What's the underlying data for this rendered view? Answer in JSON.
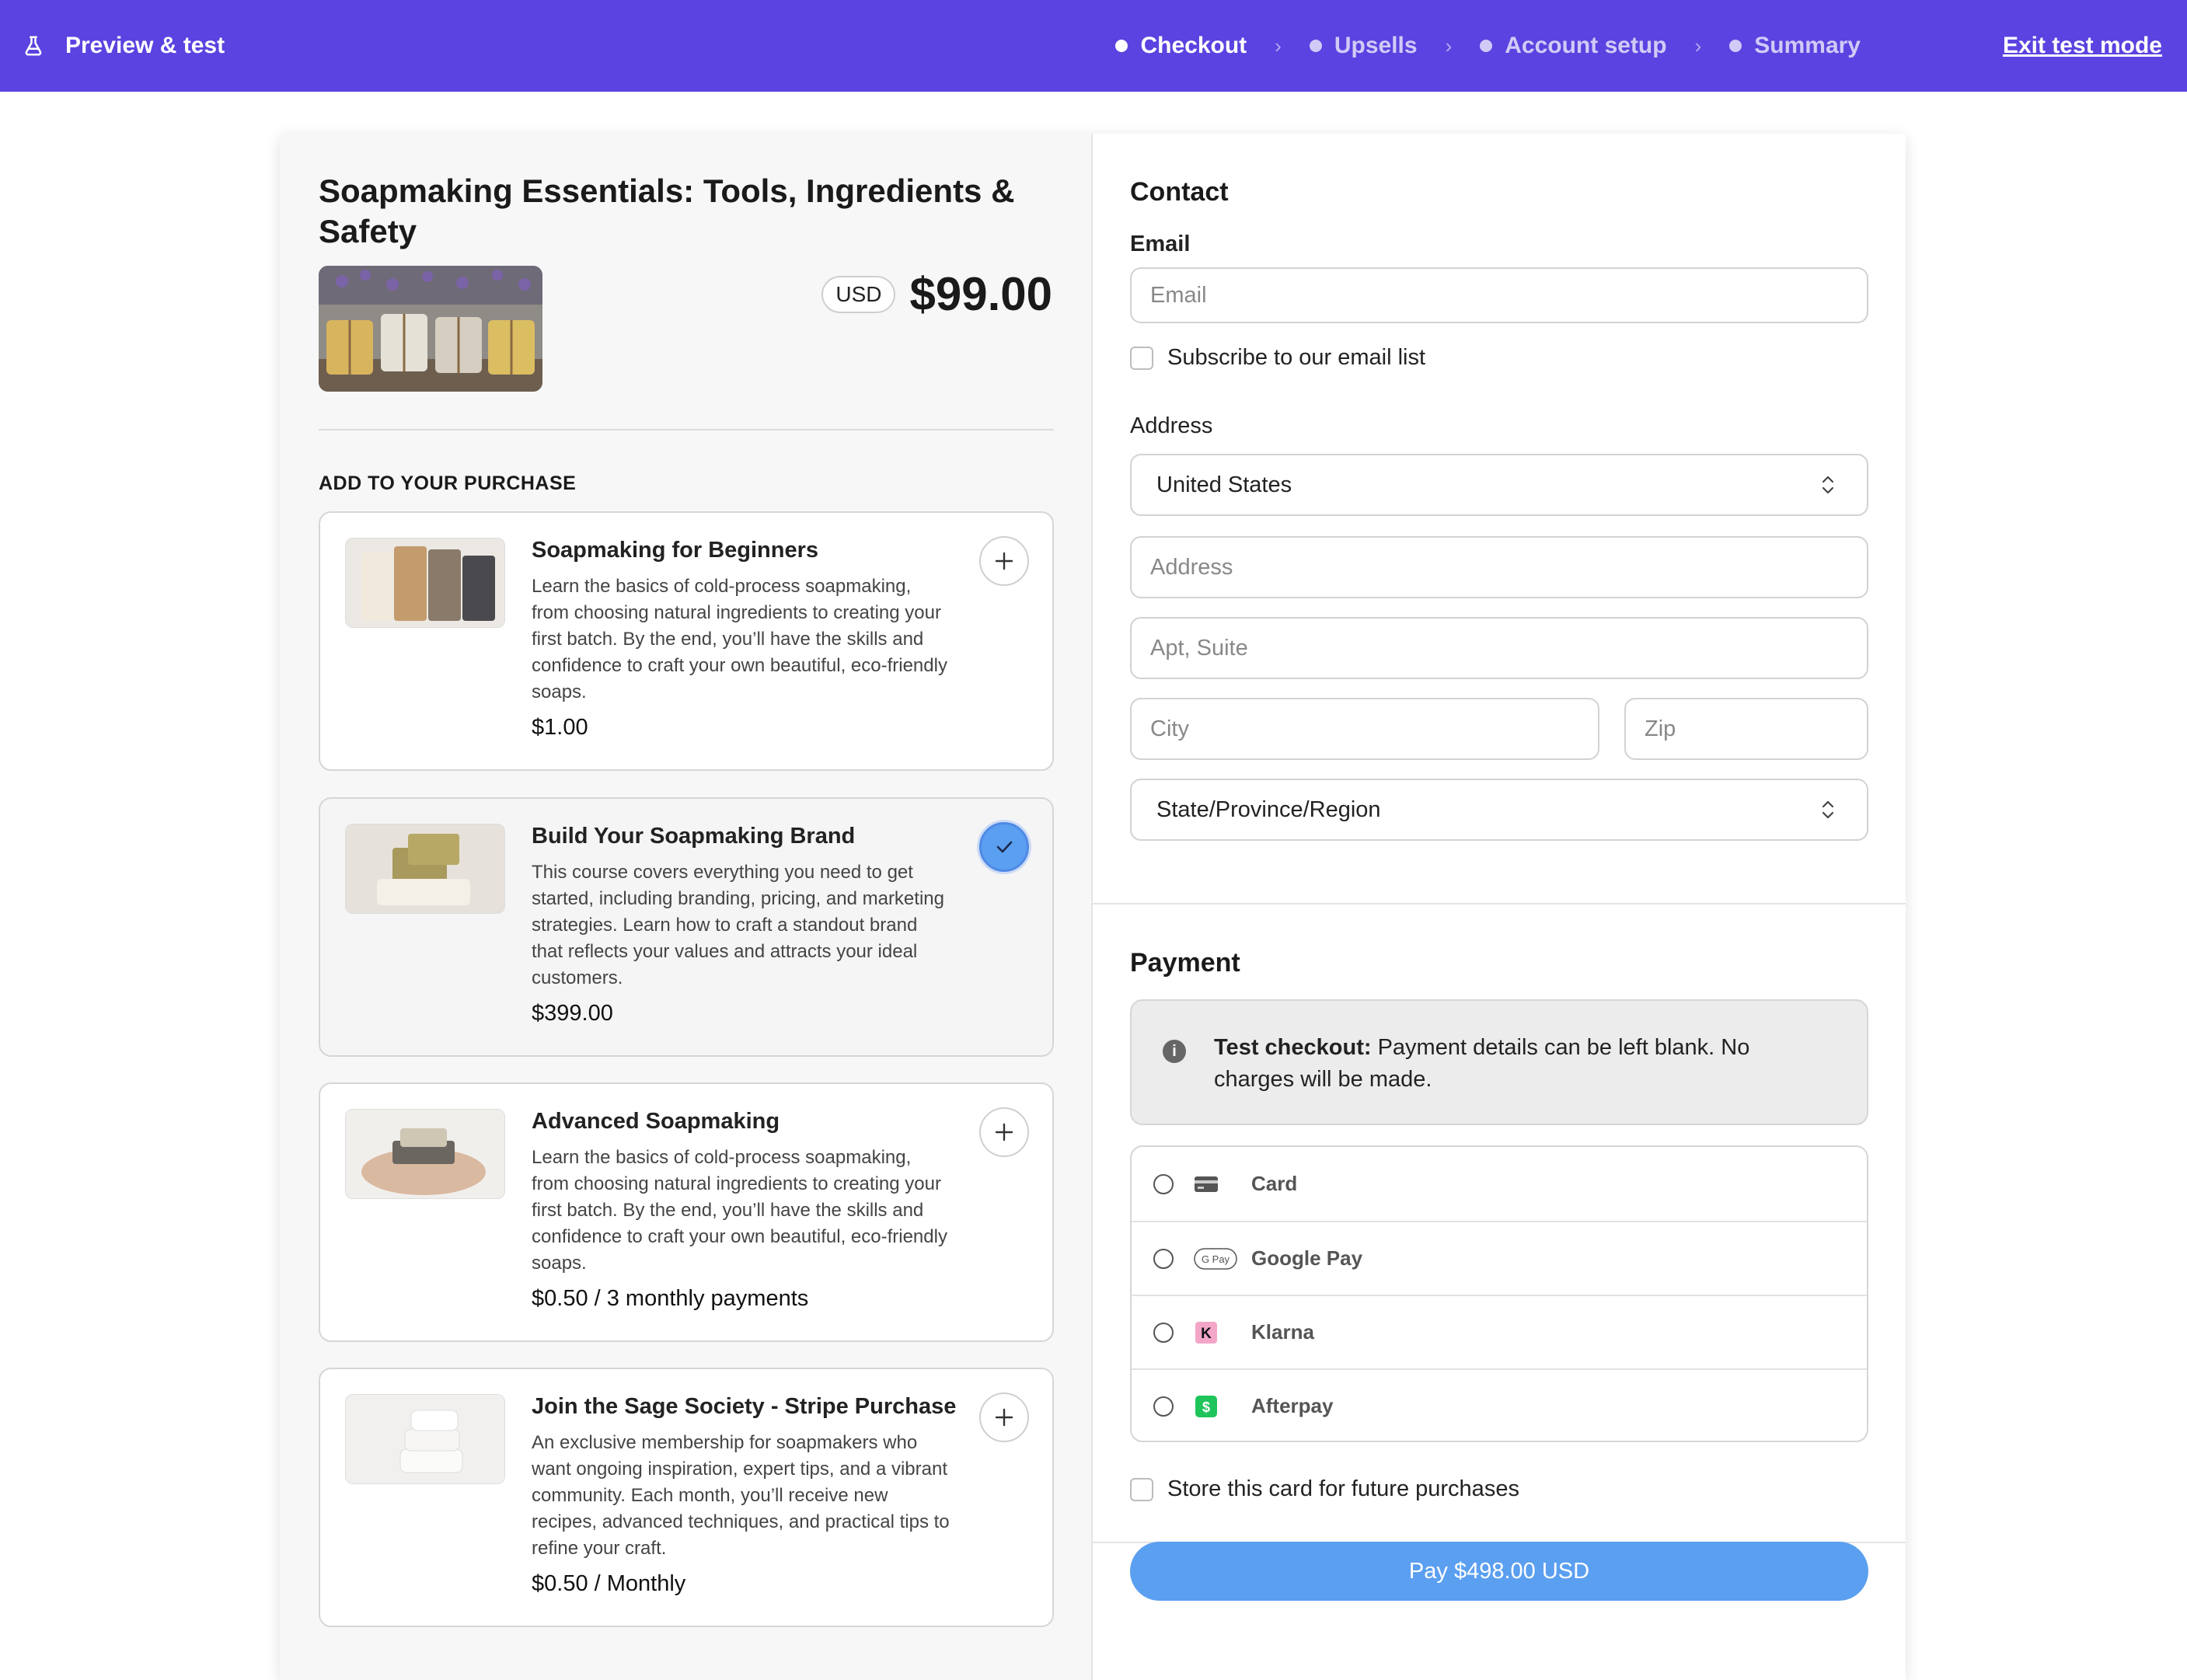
{
  "topbar": {
    "title": "Preview & test",
    "steps": [
      {
        "label": "Checkout",
        "active": true
      },
      {
        "label": "Upsells",
        "active": false
      },
      {
        "label": "Account setup",
        "active": false
      },
      {
        "label": "Summary",
        "active": false
      }
    ],
    "exit_label": "Exit test mode",
    "bg_color": "#5a43e0"
  },
  "product": {
    "title": "Soapmaking Essentials: Tools, Ingredients & Safety",
    "currency": "USD",
    "price": "$99.00"
  },
  "upsells": {
    "section_label": "ADD TO YOUR PURCHASE",
    "items": [
      {
        "title": "Soapmaking for Beginners",
        "description": "Learn the basics of cold-process soapmaking, from choosing natural ingredients to creating your first batch. By the end, you’ll have the skills and confidence to craft your own beautiful, eco-friendly soaps.",
        "price": "$1.00",
        "selected": false,
        "icon": "plus-icon"
      },
      {
        "title": "Build Your Soapmaking Brand",
        "description": "This course covers everything you need to get started, including branding, pricing, and marketing strategies. Learn how to craft a standout brand that reflects your values and attracts your ideal customers.",
        "price": "$399.00",
        "selected": true,
        "icon": "check-icon"
      },
      {
        "title": "Advanced Soapmaking",
        "description": "Learn the basics of cold-process soapmaking, from choosing natural ingredients to creating your first batch. By the end, you’ll have the skills and confidence to craft your own beautiful, eco-friendly soaps.",
        "price": "$0.50 / 3 monthly payments",
        "selected": false,
        "icon": "plus-icon"
      },
      {
        "title": "Join the Sage Society - Stripe Purchase",
        "description": "An exclusive membership for soapmakers who want ongoing inspiration, expert tips, and a vibrant community. Each month, you’ll receive new recipes, advanced techniques, and practical tips to refine your craft.",
        "price": "$0.50 / Monthly",
        "selected": false,
        "icon": "plus-icon"
      }
    ]
  },
  "contact": {
    "heading": "Contact",
    "email_label": "Email",
    "email_placeholder": "Email",
    "email_value": "",
    "subscribe_label": "Subscribe to our email list",
    "subscribe_checked": false
  },
  "address": {
    "heading": "Address",
    "country": "United States",
    "address_placeholder": "Address",
    "apt_placeholder": "Apt, Suite",
    "city_placeholder": "City",
    "zip_placeholder": "Zip",
    "state_value": "State/Province/Region"
  },
  "payment": {
    "heading": "Payment",
    "notice_bold": "Test checkout:",
    "notice_text": " Payment details can be left blank. No charges will be made.",
    "methods": [
      {
        "label": "Card",
        "icon": "credit-card-icon"
      },
      {
        "label": "Google Pay",
        "icon": "google-pay-icon"
      },
      {
        "label": "Klarna",
        "icon": "klarna-icon"
      },
      {
        "label": "Afterpay",
        "icon": "afterpay-icon"
      }
    ],
    "store_card_label": "Store this card for future purchases",
    "pay_button_label": "Pay $498.00 USD",
    "accent_color": "#5b9ff0"
  }
}
